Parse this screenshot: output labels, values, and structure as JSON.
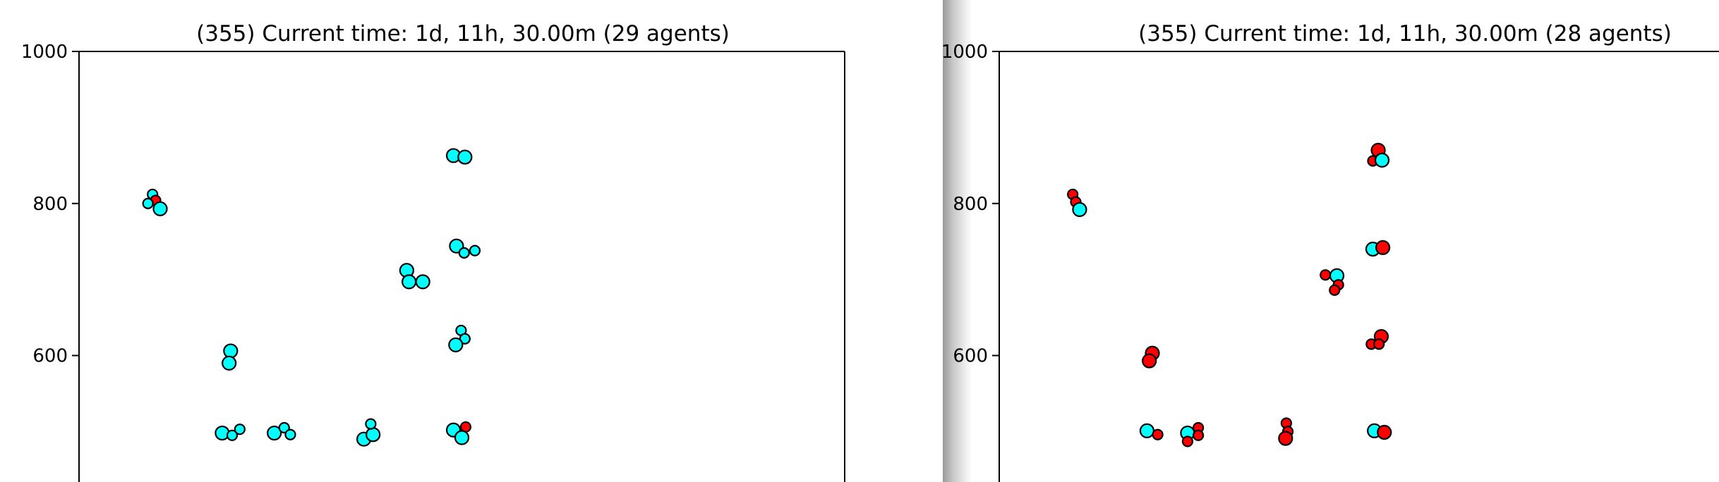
{
  "chart_data": [
    {
      "type": "scatter",
      "title": "(355) Current time: 1d, 11h, 30.00m (29 agents)",
      "xlabel": "",
      "ylabel": "",
      "xlim": [
        0,
        1000
      ],
      "ylim": [
        435,
        1000
      ],
      "yticks": [
        1000,
        800,
        600
      ],
      "grid": false,
      "colors": {
        "cyan": "#00ffff",
        "red": "#ff0000",
        "edge": "#000000"
      },
      "points": [
        {
          "x": 96,
          "y": 812,
          "color": "cyan",
          "size": "small"
        },
        {
          "x": 100,
          "y": 804,
          "color": "red",
          "size": "small"
        },
        {
          "x": 90,
          "y": 800,
          "color": "cyan",
          "size": "small"
        },
        {
          "x": 106,
          "y": 793,
          "color": "cyan",
          "size": "large"
        },
        {
          "x": 198,
          "y": 606,
          "color": "cyan",
          "size": "large"
        },
        {
          "x": 196,
          "y": 590,
          "color": "cyan",
          "size": "large"
        },
        {
          "x": 187,
          "y": 498,
          "color": "cyan",
          "size": "large"
        },
        {
          "x": 200,
          "y": 495,
          "color": "cyan",
          "size": "small"
        },
        {
          "x": 210,
          "y": 503,
          "color": "cyan",
          "size": "small"
        },
        {
          "x": 255,
          "y": 498,
          "color": "cyan",
          "size": "large"
        },
        {
          "x": 268,
          "y": 505,
          "color": "cyan",
          "size": "small"
        },
        {
          "x": 276,
          "y": 496,
          "color": "cyan",
          "size": "small"
        },
        {
          "x": 372,
          "y": 490,
          "color": "cyan",
          "size": "large"
        },
        {
          "x": 384,
          "y": 496,
          "color": "cyan",
          "size": "large"
        },
        {
          "x": 381,
          "y": 510,
          "color": "cyan",
          "size": "small"
        },
        {
          "x": 428,
          "y": 712,
          "color": "cyan",
          "size": "large"
        },
        {
          "x": 431,
          "y": 697,
          "color": "cyan",
          "size": "large"
        },
        {
          "x": 449,
          "y": 697,
          "color": "cyan",
          "size": "large"
        },
        {
          "x": 489,
          "y": 863,
          "color": "cyan",
          "size": "large"
        },
        {
          "x": 504,
          "y": 861,
          "color": "cyan",
          "size": "large"
        },
        {
          "x": 493,
          "y": 744,
          "color": "cyan",
          "size": "large"
        },
        {
          "x": 503,
          "y": 735,
          "color": "cyan",
          "size": "small"
        },
        {
          "x": 517,
          "y": 738,
          "color": "cyan",
          "size": "small"
        },
        {
          "x": 499,
          "y": 633,
          "color": "cyan",
          "size": "small"
        },
        {
          "x": 504,
          "y": 622,
          "color": "cyan",
          "size": "small"
        },
        {
          "x": 492,
          "y": 614,
          "color": "cyan",
          "size": "large"
        },
        {
          "x": 489,
          "y": 502,
          "color": "cyan",
          "size": "large"
        },
        {
          "x": 505,
          "y": 506,
          "color": "red",
          "size": "small"
        },
        {
          "x": 500,
          "y": 492,
          "color": "cyan",
          "size": "large"
        }
      ]
    },
    {
      "type": "scatter",
      "title": "(355) Current time: 1d, 11h, 30.00m (28 agents)",
      "xlabel": "",
      "ylabel": "",
      "xlim": [
        0,
        1000
      ],
      "ylim": [
        435,
        1000
      ],
      "yticks": [
        1000,
        800,
        600
      ],
      "grid": false,
      "colors": {
        "cyan": "#00ffff",
        "red": "#ff0000",
        "edge": "#000000"
      },
      "points": [
        {
          "x": 96,
          "y": 812,
          "color": "red",
          "size": "small"
        },
        {
          "x": 100,
          "y": 802,
          "color": "red",
          "size": "small"
        },
        {
          "x": 105,
          "y": 792,
          "color": "cyan",
          "size": "large"
        },
        {
          "x": 200,
          "y": 603,
          "color": "red",
          "size": "large"
        },
        {
          "x": 196,
          "y": 593,
          "color": "red",
          "size": "large"
        },
        {
          "x": 193,
          "y": 501,
          "color": "cyan",
          "size": "large"
        },
        {
          "x": 207,
          "y": 496,
          "color": "red",
          "size": "small"
        },
        {
          "x": 246,
          "y": 498,
          "color": "cyan",
          "size": "large"
        },
        {
          "x": 260,
          "y": 505,
          "color": "red",
          "size": "small"
        },
        {
          "x": 260,
          "y": 495,
          "color": "red",
          "size": "small"
        },
        {
          "x": 246,
          "y": 487,
          "color": "red",
          "size": "small"
        },
        {
          "x": 375,
          "y": 511,
          "color": "red",
          "size": "small"
        },
        {
          "x": 377,
          "y": 500,
          "color": "red",
          "size": "small"
        },
        {
          "x": 374,
          "y": 491,
          "color": "red",
          "size": "large"
        },
        {
          "x": 426,
          "y": 706,
          "color": "red",
          "size": "small"
        },
        {
          "x": 441,
          "y": 705,
          "color": "cyan",
          "size": "large"
        },
        {
          "x": 443,
          "y": 693,
          "color": "red",
          "size": "small"
        },
        {
          "x": 438,
          "y": 686,
          "color": "red",
          "size": "small"
        },
        {
          "x": 495,
          "y": 870,
          "color": "red",
          "size": "large"
        },
        {
          "x": 488,
          "y": 856,
          "color": "red",
          "size": "small"
        },
        {
          "x": 500,
          "y": 857,
          "color": "cyan",
          "size": "large"
        },
        {
          "x": 488,
          "y": 740,
          "color": "cyan",
          "size": "large"
        },
        {
          "x": 501,
          "y": 742,
          "color": "red",
          "size": "large"
        },
        {
          "x": 499,
          "y": 625,
          "color": "red",
          "size": "large"
        },
        {
          "x": 486,
          "y": 615,
          "color": "red",
          "size": "small"
        },
        {
          "x": 496,
          "y": 615,
          "color": "red",
          "size": "small"
        },
        {
          "x": 490,
          "y": 501,
          "color": "cyan",
          "size": "large"
        },
        {
          "x": 503,
          "y": 499,
          "color": "red",
          "size": "large"
        }
      ]
    }
  ]
}
